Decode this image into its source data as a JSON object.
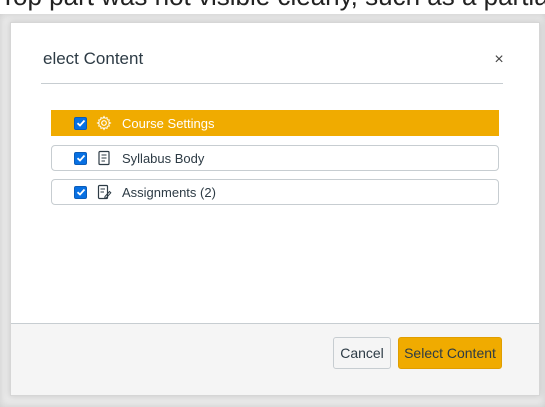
{
  "top_text": "Top part was not visible clearly, such as a partial sentence that is cut off",
  "modal": {
    "title": "elect Content",
    "close_label": "×"
  },
  "items": [
    {
      "label": "Course Settings",
      "checked": true,
      "selected": true,
      "icon": "gear-icon"
    },
    {
      "label": "Syllabus Body",
      "checked": true,
      "selected": false,
      "icon": "document-icon"
    },
    {
      "label": "Assignments (2)",
      "checked": true,
      "selected": false,
      "icon": "assignment-icon",
      "arrow": "→"
    }
  ],
  "footer": {
    "cancel_label": "Cancel",
    "select_label": "Select Content"
  },
  "colors": {
    "accent": "#f0ab00",
    "checkbox": "#0770e3"
  }
}
